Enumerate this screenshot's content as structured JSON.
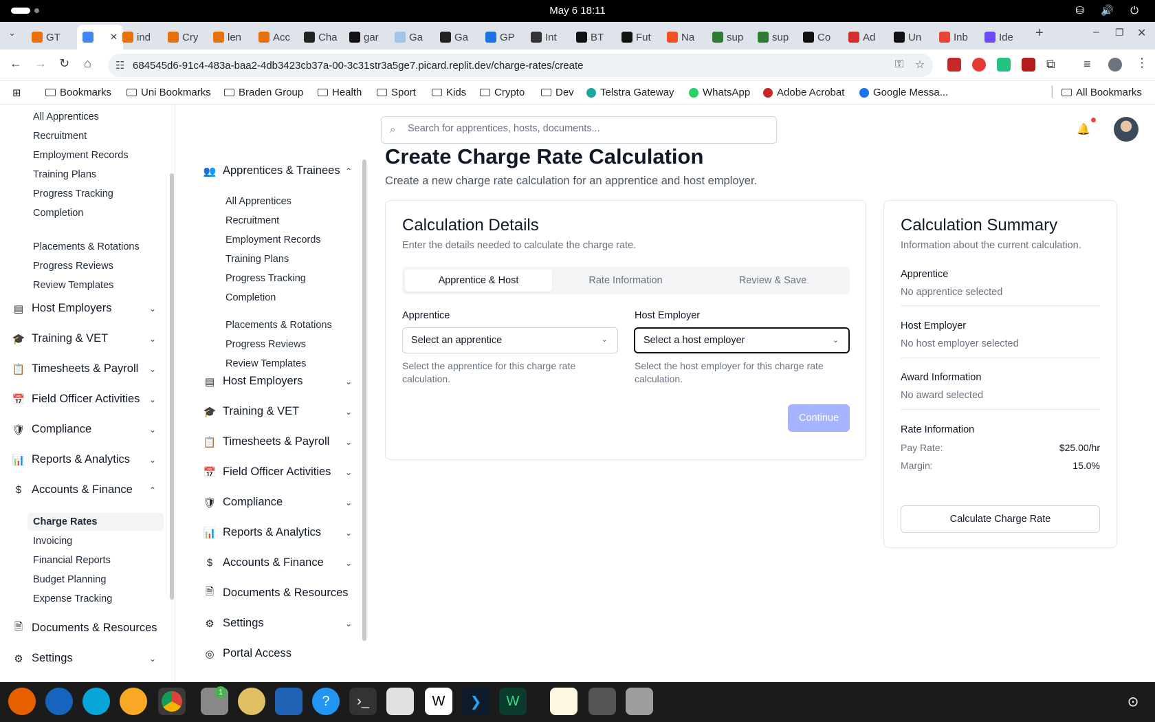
{
  "system": {
    "clock": "May 6  18:11"
  },
  "browser": {
    "tabs": [
      "GT",
      "",
      "ind",
      "Cry",
      "len",
      "Acc",
      "Cha",
      "gar",
      "Ga",
      "Ga",
      "GP",
      "Int",
      "BT",
      "Fut",
      "Na",
      "sup",
      "sup",
      "Co",
      "Ad",
      "Un",
      "Inb",
      "Ide"
    ],
    "active_tab_index": 1,
    "url": "684545d6-91c4-483a-baa2-4db3423cb37a-00-3c31str3a5ge7.picard.replit.dev/charge-rates/create",
    "bookmarks": [
      "Bookmarks",
      "Uni Bookmarks",
      "Braden Group",
      "Health",
      "Sport",
      "Kids",
      "Crypto",
      "Dev",
      "Telstra Gateway",
      "WhatsApp",
      "Adobe Acrobat",
      "Google Messa..."
    ],
    "all_bookmarks": "All Bookmarks"
  },
  "search": {
    "placeholder": "Search for apprentices, hosts, documents..."
  },
  "sidebar1": {
    "apprentice_items": [
      "All Apprentices",
      "Recruitment",
      "Employment Records",
      "Training Plans",
      "Progress Tracking",
      "Completion"
    ],
    "placement_items": [
      "Placements & Rotations",
      "Progress Reviews",
      "Review Templates"
    ],
    "sections": [
      "Host Employers",
      "Training & VET",
      "Timesheets & Payroll",
      "Field Officer Activities",
      "Compliance",
      "Reports & Analytics",
      "Accounts & Finance"
    ],
    "finance_items": [
      "Charge Rates",
      "Invoicing",
      "Financial Reports",
      "Budget Planning",
      "Expense Tracking"
    ],
    "bottom": [
      "Documents & Resources",
      "Settings"
    ]
  },
  "sidebar2": {
    "group_title": "Apprentices & Trainees",
    "items": [
      "All Apprentices",
      "Recruitment",
      "Employment Records",
      "Training Plans",
      "Progress Tracking",
      "Completion"
    ],
    "placement_items": [
      "Placements & Rotations",
      "Progress Reviews",
      "Review Templates"
    ],
    "sections": [
      "Host Employers",
      "Training & VET",
      "Timesheets & Payroll",
      "Field Officer Activities",
      "Compliance",
      "Reports & Analytics",
      "Accounts & Finance",
      "Documents & Resources",
      "Settings",
      "Portal Access"
    ]
  },
  "page": {
    "title": "Create Charge Rate Calculation",
    "subtitle": "Create a new charge rate calculation for an apprentice and host employer."
  },
  "calc": {
    "title": "Calculation Details",
    "desc": "Enter the details needed to calculate the charge rate.",
    "tabs": [
      "Apprentice & Host",
      "Rate Information",
      "Review & Save"
    ],
    "apprentice_label": "Apprentice",
    "apprentice_value": "Select an apprentice",
    "apprentice_help": "Select the apprentice for this charge rate calculation.",
    "host_label": "Host Employer",
    "host_value": "Select a host employer",
    "host_help": "Select the host employer for this charge rate calculation.",
    "continue": "Continue"
  },
  "summary": {
    "title": "Calculation Summary",
    "desc": "Information about the current calculation.",
    "apprentice_h": "Apprentice",
    "apprentice_v": "No apprentice selected",
    "host_h": "Host Employer",
    "host_v": "No host employer selected",
    "award_h": "Award Information",
    "award_v": "No award selected",
    "rate_h": "Rate Information",
    "pay_label": "Pay Rate:",
    "pay_value": "$25.00/hr",
    "margin_label": "Margin:",
    "margin_value": "15.0%",
    "button": "Calculate Charge Rate"
  },
  "colors": {
    "continue_disabled": "#a5b4fc",
    "notification_dot": "#ef4444"
  }
}
